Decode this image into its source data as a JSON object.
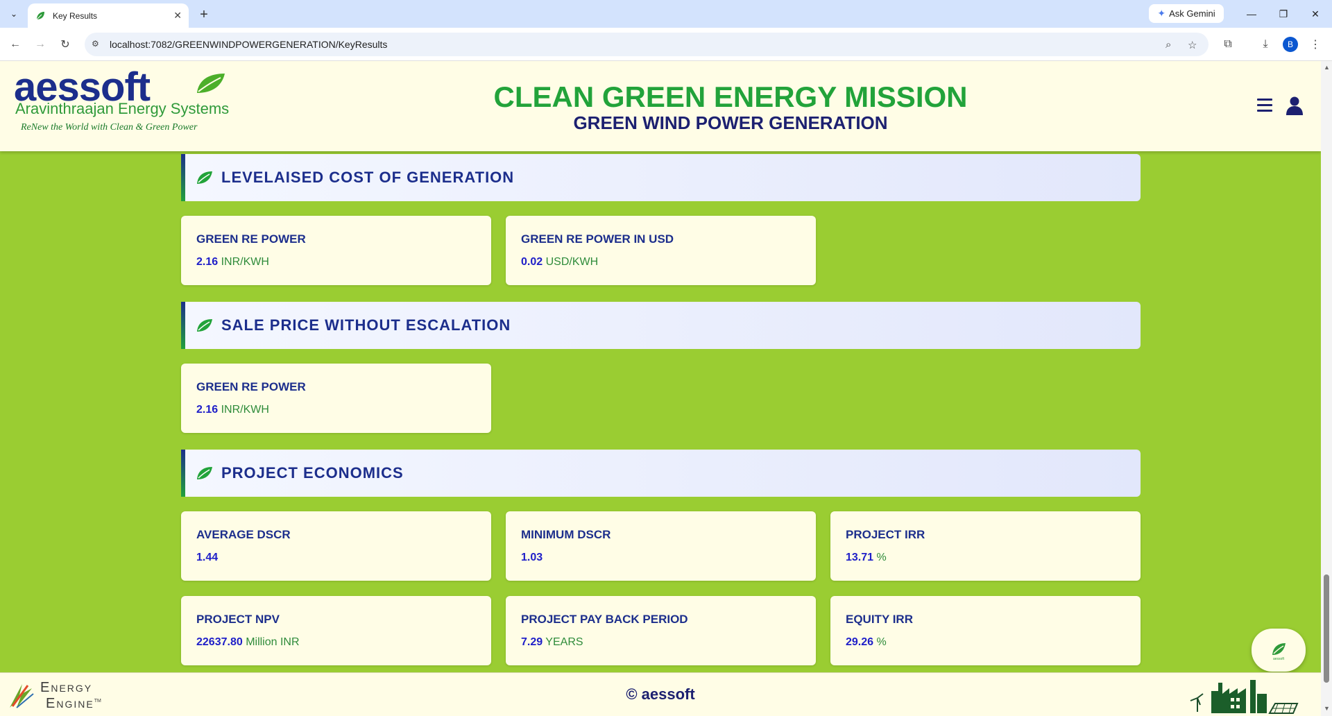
{
  "browser": {
    "tab_title": "Key Results",
    "url": "localhost:7082/GREENWINDPOWERGENERATION/KeyResults",
    "ask_gemini": "Ask Gemini",
    "profile_initial": "B"
  },
  "header": {
    "logo_word": "aessoft",
    "logo_subtitle": "Aravinthraajan Energy Systems",
    "logo_tagline": "ReNew the World with Clean & Green Power",
    "title": "CLEAN GREEN ENERGY MISSION",
    "subtitle": "GREEN WIND POWER GENERATION"
  },
  "sections": [
    {
      "title": "LEVELAISED COST OF GENERATION",
      "cards": [
        {
          "label": "GREEN RE POWER",
          "value": "2.16",
          "unit": "INR/KWH"
        },
        {
          "label": "GREEN RE POWER IN USD",
          "value": "0.02",
          "unit": "USD/KWH"
        }
      ]
    },
    {
      "title": "SALE PRICE WITHOUT ESCALATION",
      "cards": [
        {
          "label": "GREEN RE POWER",
          "value": "2.16",
          "unit": "INR/KWH"
        }
      ]
    },
    {
      "title": "PROJECT ECONOMICS",
      "cards": [
        {
          "label": "AVERAGE DSCR",
          "value": "1.44",
          "unit": ""
        },
        {
          "label": "MINIMUM DSCR",
          "value": "1.03",
          "unit": ""
        },
        {
          "label": "PROJECT IRR",
          "value": "13.71",
          "unit": "%"
        },
        {
          "label": "PROJECT NPV",
          "value": "22637.80",
          "unit": "Million INR"
        },
        {
          "label": "PROJECT PAY BACK PERIOD",
          "value": "7.29",
          "unit": "YEARS"
        },
        {
          "label": "EQUITY IRR",
          "value": "29.26",
          "unit": "%"
        }
      ]
    }
  ],
  "footer": {
    "energy_line1": "Energy",
    "energy_line2": "Engine",
    "tm": "TM",
    "copyright": "© aessoft"
  },
  "fab": {
    "label": "aessoft"
  },
  "colors": {
    "page_bg": "#9acd32",
    "header_bg": "#fffde6",
    "brand_navy": "#1c2e8c",
    "brand_green": "#22a33a",
    "value_blue": "#1e1ec8"
  }
}
